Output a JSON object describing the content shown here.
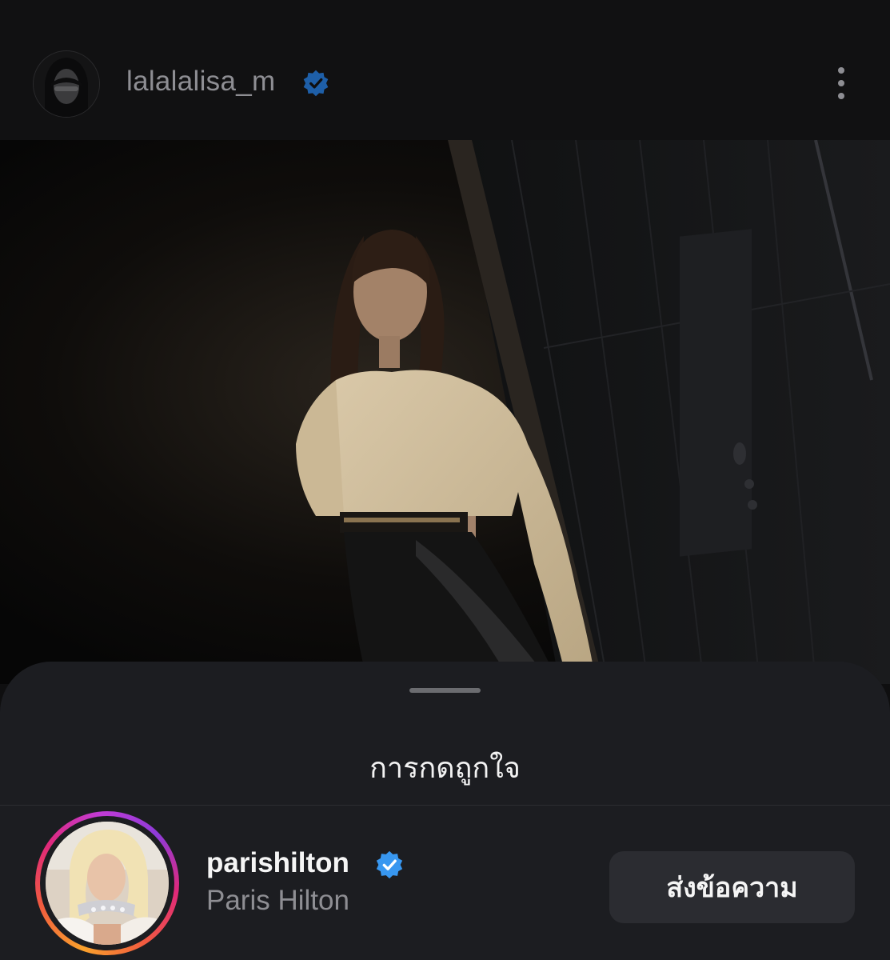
{
  "header": {
    "username": "lalalalisa_m",
    "verified_icon": "verified-badge-icon",
    "more_icon": "more-vertical-icon"
  },
  "post": {
    "image_icon": "post-photo"
  },
  "likes_sheet": {
    "title": "การกดถูกใจ",
    "likers": [
      {
        "username": "parishilton",
        "full_name": "Paris Hilton",
        "verified": true,
        "has_story": true,
        "action_label": "ส่งข้อความ"
      }
    ]
  },
  "colors": {
    "background": "#111112",
    "sheet": "#1c1d21",
    "button": "#2b2c31",
    "verified_blue": "#3897f0",
    "muted_text": "#8e8e93"
  }
}
